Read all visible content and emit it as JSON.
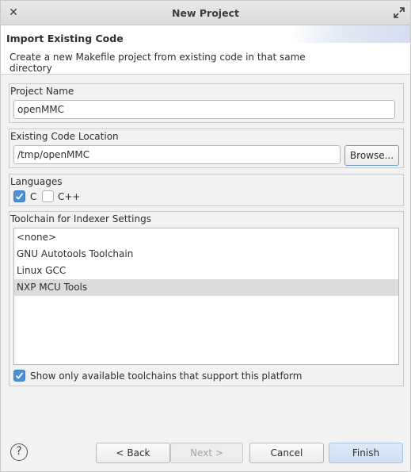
{
  "window": {
    "title": "New Project"
  },
  "header": {
    "title": "Import Existing Code",
    "description": "Create a new Makefile project from existing code in that same directory"
  },
  "project_name": {
    "label": "Project Name",
    "value": "openMMC"
  },
  "code_location": {
    "label": "Existing Code Location",
    "value": "/tmp/openMMC",
    "browse_label": "Browse..."
  },
  "languages": {
    "label": "Languages",
    "c_label": "C",
    "c_checked": true,
    "cpp_label": "C++",
    "cpp_checked": false
  },
  "toolchain": {
    "label": "Toolchain for Indexer Settings",
    "items": [
      "<none>",
      "GNU Autotools Toolchain",
      "Linux GCC",
      "NXP MCU Tools"
    ],
    "selected": "NXP MCU Tools",
    "filter_label": "Show only available toolchains that support this platform",
    "filter_checked": true
  },
  "buttons": {
    "back": "< Back",
    "next": "Next >",
    "cancel": "Cancel",
    "finish": "Finish"
  },
  "icons": {
    "close": "close-icon",
    "maximize": "maximize-icon",
    "help": "help-icon"
  },
  "colors": {
    "accent": "#4a90d9",
    "selection": "#dcdcdc"
  }
}
